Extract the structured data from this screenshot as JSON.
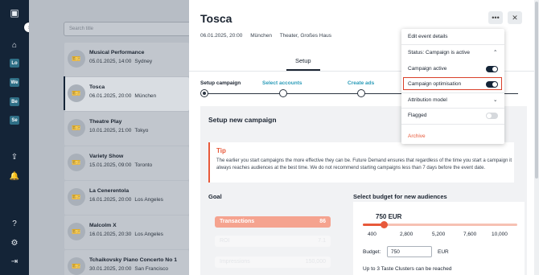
{
  "sidebar_nav": {
    "items": [
      {
        "name": "home-icon",
        "glyph": "⌂"
      },
      {
        "name": "lo-item",
        "label": "Lo"
      },
      {
        "name": "we-item",
        "label": "We"
      },
      {
        "name": "be-item",
        "label": "Be"
      },
      {
        "name": "se-item",
        "label": "Se"
      }
    ]
  },
  "event_list": {
    "search_placeholder": "Search title",
    "events": [
      {
        "title": "Musical Performance",
        "date": "05.01.2025, 14:00",
        "city": "Sydney"
      },
      {
        "title": "Tosca",
        "date": "06.01.2025, 20:00",
        "city": "München"
      },
      {
        "title": "Theatre Play",
        "date": "10.01.2025, 21:00",
        "city": "Tokyo"
      },
      {
        "title": "Variety Show",
        "date": "15.01.2025, 09:00",
        "city": "Toronto"
      },
      {
        "title": "La Cenerentola",
        "date": "16.01.2025, 20:00",
        "city": "Los Angeles"
      },
      {
        "title": "Malcolm X",
        "date": "16.01.2025, 20:30",
        "city": "Los Angeles"
      },
      {
        "title": "Tchaikovsky Piano Concerto No 1",
        "date": "30.01.2025, 20:00",
        "city": "San Francisco"
      }
    ]
  },
  "event_detail": {
    "title": "Tosca",
    "date": "06.01.2025, 20:00",
    "city": "München",
    "venue": "Theater, Großes Haus",
    "tab": "Setup",
    "steps": [
      "Setup campaign",
      "Select accounts",
      "Create ads"
    ],
    "section_title": "Setup new campaign",
    "tip": {
      "title": "Tip",
      "text": "The earlier you start campaigns the more effective they can be. Future Demand ensures that regardless of the time you start a campaign it always reaches audiences at the best time. We do not recommend starting campaigns less than 7 days before the event date."
    },
    "goal": {
      "title": "Goal",
      "options": [
        {
          "label": "Transactions",
          "value": "86",
          "active": true
        },
        {
          "label": "ROI",
          "value": "7.1",
          "active": false
        },
        {
          "label": "Impressions",
          "value": "150,000",
          "active": false
        }
      ]
    },
    "budget": {
      "title": "Select budget for new audiences",
      "slider_value": "750 EUR",
      "ticks": [
        "400",
        "2,800",
        "5,200",
        "7,600",
        "10,000"
      ],
      "label": "Budget:",
      "input_value": "750",
      "currency": "EUR",
      "note": "Up to 3 Taste Clusters can be reached"
    }
  },
  "dropdown_menu": {
    "edit": "Edit event details",
    "status": "Status: Campaign is active",
    "campaign_active": "Campaign active",
    "campaign_optimisation": "Campaign optimisation",
    "attribution": "Attribution model",
    "flagged": "Flagged",
    "archive": "Archive"
  },
  "colors": {
    "nav_bg": "#142437",
    "accent": "#e8593a",
    "link": "#2a9bb8"
  }
}
